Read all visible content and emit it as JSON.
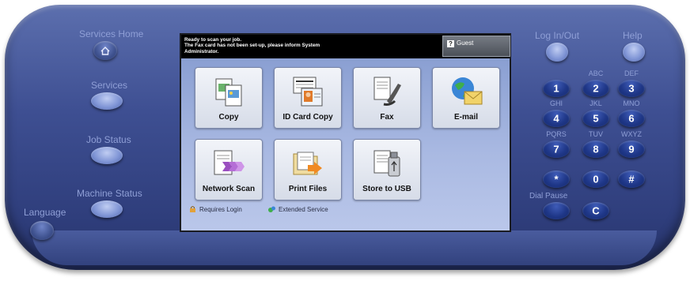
{
  "hardware": {
    "services_home_label": "Services Home",
    "services_label": "Services",
    "job_status_label": "Job Status",
    "machine_status_label": "Machine Status",
    "language_label": "Language",
    "log_in_out_label": "Log In/Out",
    "help_label": "Help",
    "dial_pause_label": "Dial Pause",
    "clear_label": "C"
  },
  "keypad": {
    "keys": [
      {
        "digit": "1",
        "letters": ""
      },
      {
        "digit": "2",
        "letters": "ABC"
      },
      {
        "digit": "3",
        "letters": "DEF"
      },
      {
        "digit": "4",
        "letters": "GHI"
      },
      {
        "digit": "5",
        "letters": "JKL"
      },
      {
        "digit": "6",
        "letters": "MNO"
      },
      {
        "digit": "7",
        "letters": "PQRS"
      },
      {
        "digit": "8",
        "letters": "TUV"
      },
      {
        "digit": "9",
        "letters": "WXYZ"
      },
      {
        "digit": "*",
        "letters": ""
      },
      {
        "digit": "0",
        "letters": ""
      },
      {
        "digit": "#",
        "letters": ""
      }
    ]
  },
  "screen": {
    "status_message": "Ready to scan your job.\nThe Fax card has not been set-up, please inform System\nAdministrator.",
    "user_label": "Guest",
    "tiles": [
      {
        "label": "Copy",
        "icon": "copy-icon"
      },
      {
        "label": "ID Card Copy",
        "icon": "id-card-copy-icon"
      },
      {
        "label": "Fax",
        "icon": "fax-icon"
      },
      {
        "label": "E-mail",
        "icon": "email-icon"
      },
      {
        "label": "Network Scan",
        "icon": "network-scan-icon"
      },
      {
        "label": "Print Files",
        "icon": "print-files-icon"
      },
      {
        "label": "Store to USB",
        "icon": "store-to-usb-icon"
      }
    ],
    "legend": {
      "requires_login": "Requires Login",
      "extended_service": "Extended Service"
    }
  },
  "colors": {
    "bezel": "#3e4f92",
    "screen_background": "#a9b9e2",
    "status_bar": "#000000",
    "keypad_key": "#1f3788"
  }
}
